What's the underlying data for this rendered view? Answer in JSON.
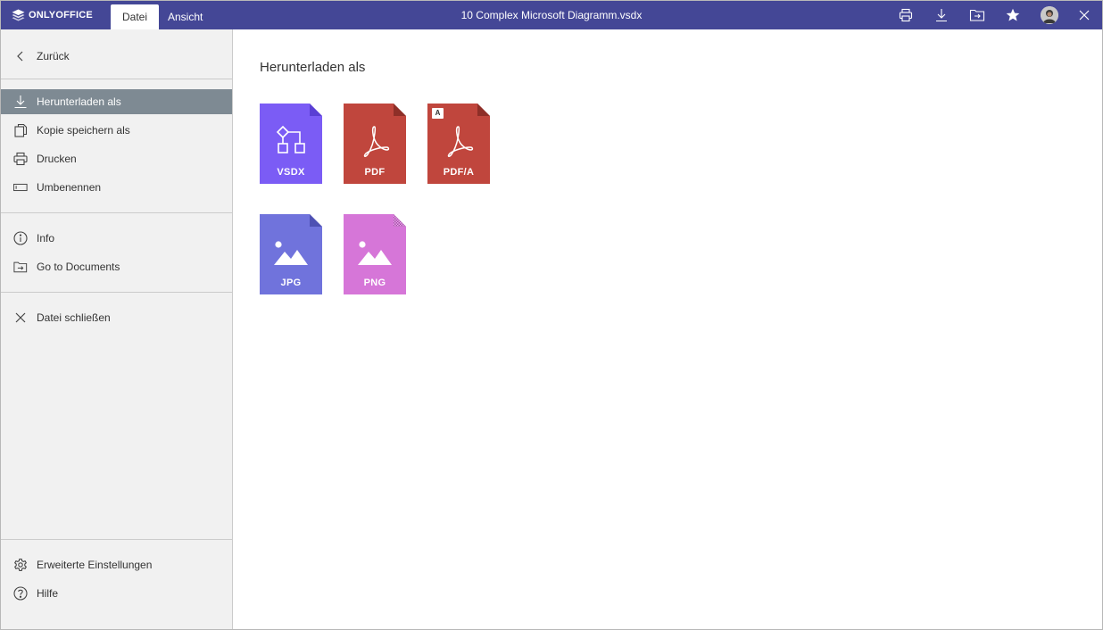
{
  "header": {
    "brand": "ONLYOFFICE",
    "tabs": [
      {
        "label": "Datei"
      },
      {
        "label": "Ansicht"
      }
    ],
    "document_title": "10 Complex Microsoft Diagramm.vsdx",
    "actions": [
      "printer-icon",
      "download-icon",
      "open-location-icon",
      "favorite-star-icon",
      "user-avatar",
      "close-icon"
    ],
    "colors": {
      "bar": "#444796"
    }
  },
  "sidebar": {
    "back_label": "Zurück",
    "items": [
      {
        "label": "Herunterladen als",
        "icon": "download-icon",
        "active": true
      },
      {
        "label": "Kopie speichern als",
        "icon": "copy-icon"
      },
      {
        "label": "Drucken",
        "icon": "printer-icon"
      },
      {
        "label": "Umbenennen",
        "icon": "rename-icon"
      },
      {
        "label": "Info",
        "icon": "info-icon"
      },
      {
        "label": "Go to Documents",
        "icon": "folder-arrow-icon"
      },
      {
        "label": "Datei schließen",
        "icon": "close-icon"
      },
      {
        "label": "Erweiterte Einstellungen",
        "icon": "gear-icon"
      },
      {
        "label": "Hilfe",
        "icon": "help-icon"
      }
    ],
    "active_color": "#7e8a93"
  },
  "main": {
    "title": "Herunterladen als",
    "formats": [
      {
        "label": "VSDX",
        "icon": "diagram-icon",
        "color": "#7b5cf5",
        "fold": "#5a3fd4"
      },
      {
        "label": "PDF",
        "icon": "acrobat-icon",
        "color": "#c0463d",
        "fold": "#8e2f28"
      },
      {
        "label": "PDF/A",
        "icon": "acrobat-icon",
        "badge": "A",
        "color": "#c0463d",
        "fold": "#8e2f28"
      },
      {
        "label": "JPG",
        "icon": "image-icon",
        "color": "#7073dc",
        "fold": "#4e51b3"
      },
      {
        "label": "PNG",
        "icon": "image-icon",
        "color": "#d676d8",
        "fold": "#a84aaa"
      }
    ]
  }
}
